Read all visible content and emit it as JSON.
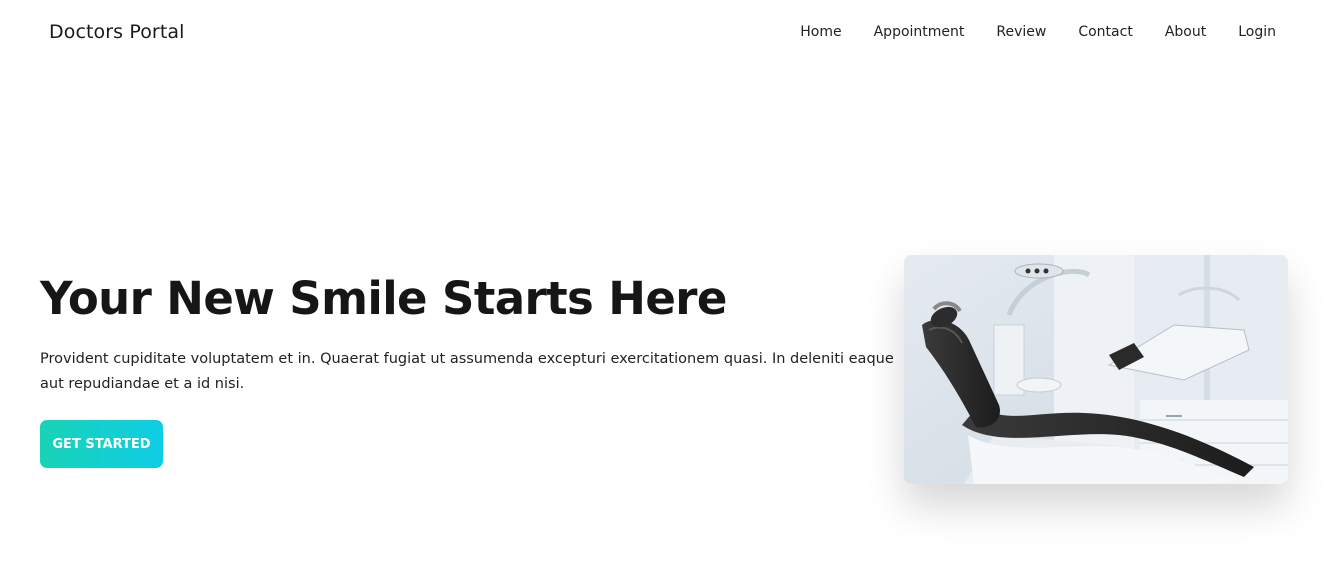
{
  "navbar": {
    "brand": "Doctors Portal",
    "links": [
      "Home",
      "Appointment",
      "Review",
      "Contact",
      "About",
      "Login"
    ]
  },
  "hero": {
    "title": "Your New Smile Starts Here",
    "description": "Provident cupiditate voluptatem et in. Quaerat fugiat ut assumenda excepturi exercitationem quasi. In deleniti eaque aut repudiandae et a id nisi.",
    "cta_label": "GET STARTED",
    "image_icon": "dental-chair-photo"
  },
  "colors": {
    "cta_gradient_start": "#19d3b6",
    "cta_gradient_end": "#0fcde6",
    "text": "#161616",
    "background": "#ffffff"
  }
}
